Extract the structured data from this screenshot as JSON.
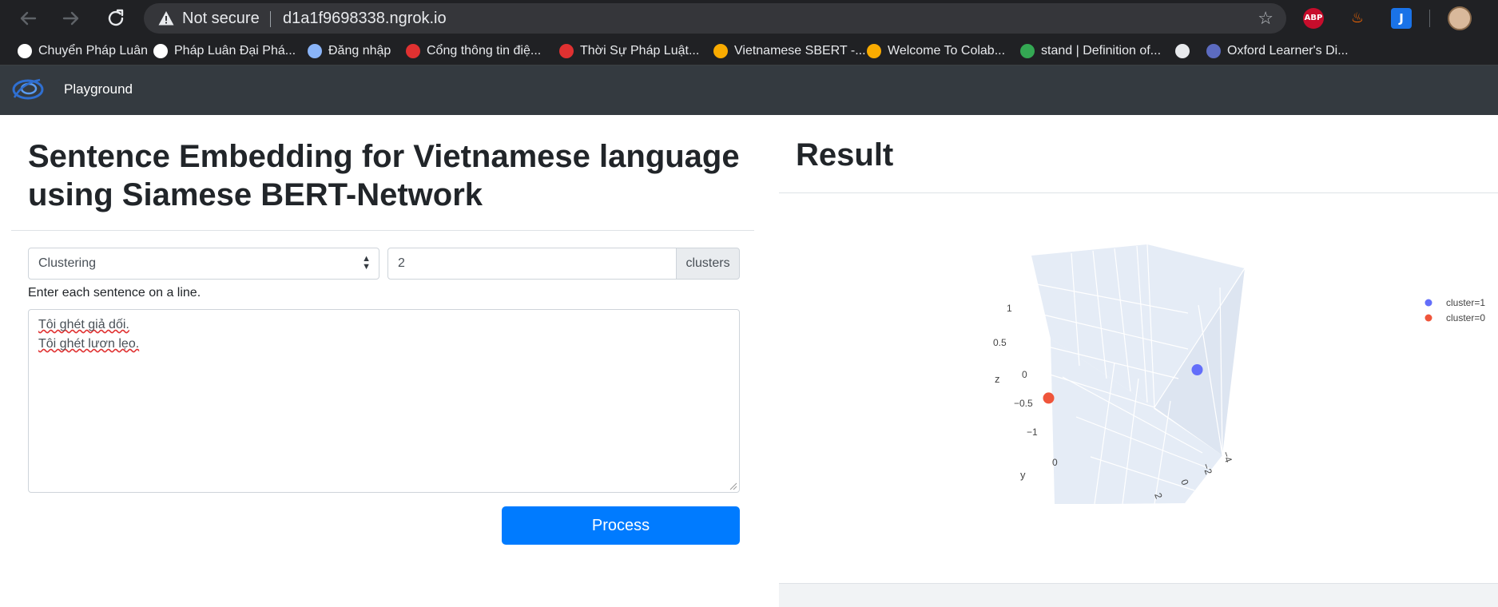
{
  "browser": {
    "not_secure": "Not secure",
    "url": "d1a1f9698338.ngrok.io",
    "back_icon": "arrow-left-icon",
    "forward_icon": "arrow-right-icon",
    "reload_icon": "reload-icon",
    "extensions": {
      "abp": "ABP",
      "j": "J"
    },
    "bookmarks": [
      {
        "label": "Chuyển Pháp Luân",
        "icon_color": "#ffffff"
      },
      {
        "label": "Pháp Luân Đại Phá...",
        "icon_color": "#ffffff"
      },
      {
        "label": "Đăng nhập",
        "icon_color": "#8ab4f8"
      },
      {
        "label": "Cổng thông tin điệ...",
        "icon_color": "#e03131"
      },
      {
        "label": "Thời Sự Pháp Luật...",
        "icon_color": "#e03131"
      },
      {
        "label": "Vietnamese SBERT -...",
        "icon_color": "#f9ab00"
      },
      {
        "label": "Welcome To Colab...",
        "icon_color": "#f9ab00"
      },
      {
        "label": "stand | Definition of...",
        "icon_color": "#34a853"
      },
      {
        "label": "",
        "icon_color": "#e8eaed"
      },
      {
        "label": "Oxford Learner's Di...",
        "icon_color": "#5c6bc0"
      }
    ]
  },
  "navbar": {
    "link": "Playground"
  },
  "form": {
    "title": "Sentence Embedding for Vietnamese language using Siamese BERT-Network",
    "mode": "Clustering",
    "clusters_value": "2",
    "clusters_addon": "clusters",
    "hint": "Enter each sentence on a line.",
    "sentences": [
      "Tôi ghét giả dối.",
      "Tôi ghét lươn lẹo."
    ],
    "process_label": "Process"
  },
  "result": {
    "title": "Result",
    "legend": [
      {
        "label": "cluster=1",
        "color": "#636efa"
      },
      {
        "label": "cluster=0",
        "color": "#ef553b"
      }
    ],
    "axis_labels": {
      "x": "",
      "y": "y",
      "z": "z"
    },
    "z_ticks": [
      "1",
      "0.5",
      "0",
      "−0.5",
      "−1"
    ],
    "y_ticks": [
      "0"
    ],
    "x_ticks": [
      "2",
      "0",
      "−2",
      "−4"
    ]
  },
  "chart_data": {
    "type": "scatter",
    "title": "",
    "series": [
      {
        "name": "cluster=1",
        "color": "#636efa",
        "points": [
          {
            "x": -2.5,
            "y": -1.5,
            "z": 0.0
          }
        ]
      },
      {
        "name": "cluster=0",
        "color": "#ef553b",
        "points": [
          {
            "x": 2.0,
            "y": 1.5,
            "z": -0.3
          }
        ]
      }
    ],
    "zlim": [
      -1,
      1
    ],
    "grid": true,
    "legend_position": "top-right"
  }
}
